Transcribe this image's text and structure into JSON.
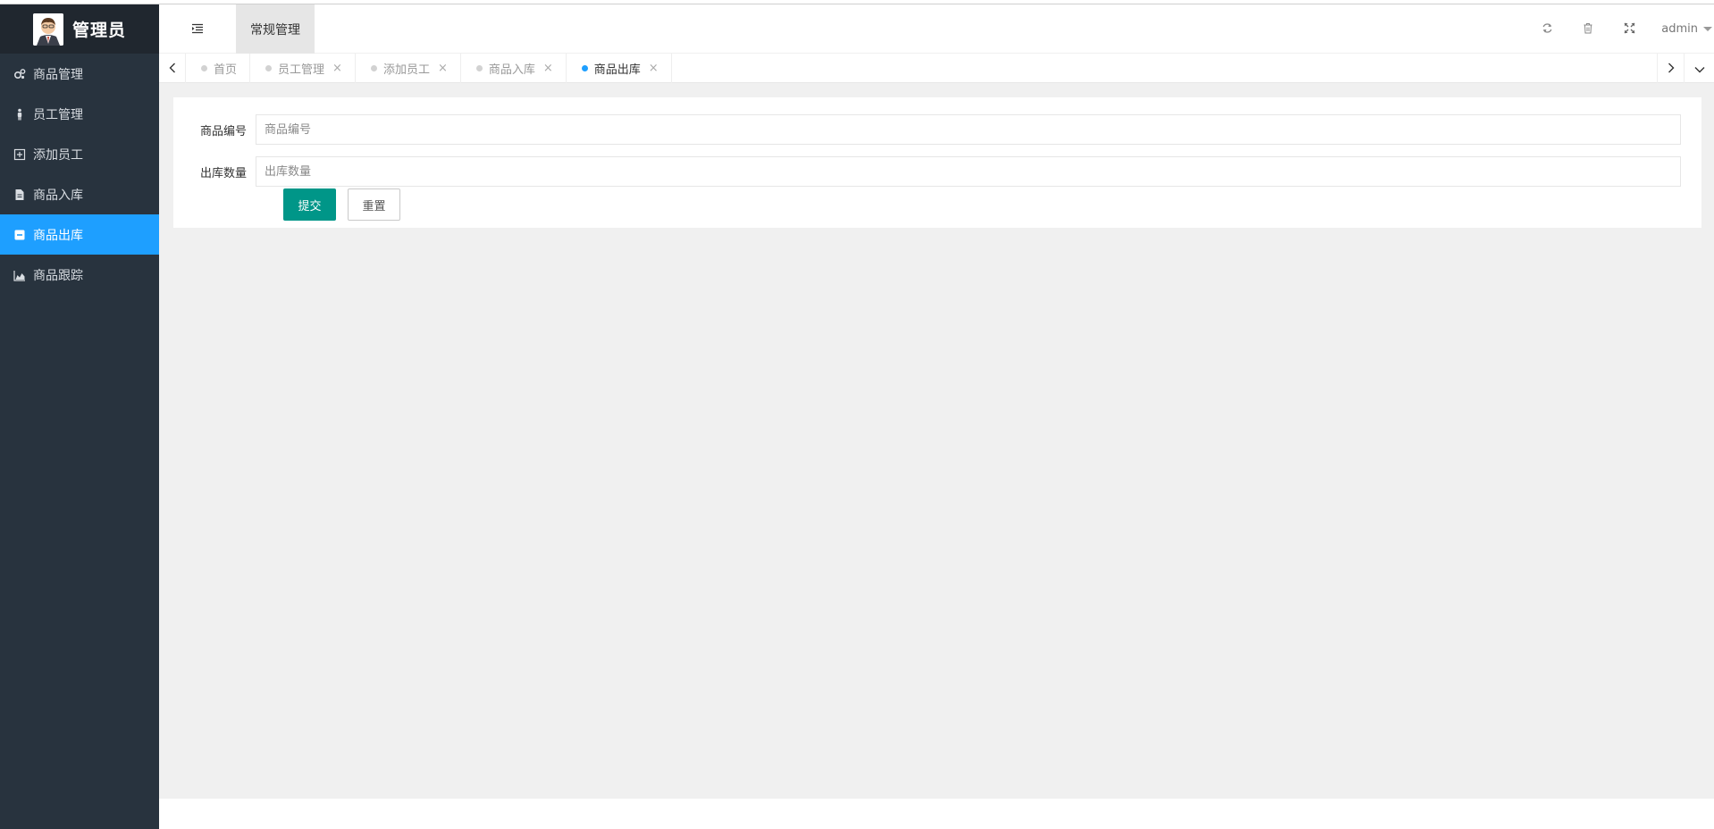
{
  "app": {
    "title": "管理员"
  },
  "sidebar": {
    "items": [
      {
        "label": "商品管理",
        "icon": "gears-icon",
        "active": false
      },
      {
        "label": "员工管理",
        "icon": "person-icon",
        "active": false
      },
      {
        "label": "添加员工",
        "icon": "plus-square-icon",
        "active": false
      },
      {
        "label": "商品入库",
        "icon": "document-icon",
        "active": false
      },
      {
        "label": "商品出库",
        "icon": "minus-square-icon",
        "active": true
      },
      {
        "label": "商品跟踪",
        "icon": "area-chart-icon",
        "active": false
      }
    ]
  },
  "header": {
    "tab_label": "常规管理",
    "user": "admin",
    "icons": [
      "menu-collapse-icon",
      "refresh-icon",
      "trash-icon",
      "fullscreen-icon"
    ]
  },
  "tabbar": {
    "tabs": [
      {
        "label": "首页",
        "closable": false,
        "active": false
      },
      {
        "label": "员工管理",
        "closable": true,
        "active": false
      },
      {
        "label": "添加员工",
        "closable": true,
        "active": false
      },
      {
        "label": "商品入库",
        "closable": true,
        "active": false
      },
      {
        "label": "商品出库",
        "closable": true,
        "active": true
      }
    ],
    "close_glyph": "×"
  },
  "form": {
    "fields": [
      {
        "label": "商品编号",
        "placeholder": "商品编号",
        "value": ""
      },
      {
        "label": "出库数量",
        "placeholder": "出库数量",
        "value": ""
      }
    ],
    "submit_label": "提交",
    "reset_label": "重置"
  },
  "colors": {
    "sidebar_bg": "#28333e",
    "logo_bg": "#20272f",
    "active_blue": "#1e9fff",
    "submit_green": "#009688",
    "content_bg": "#f0f0f0"
  }
}
